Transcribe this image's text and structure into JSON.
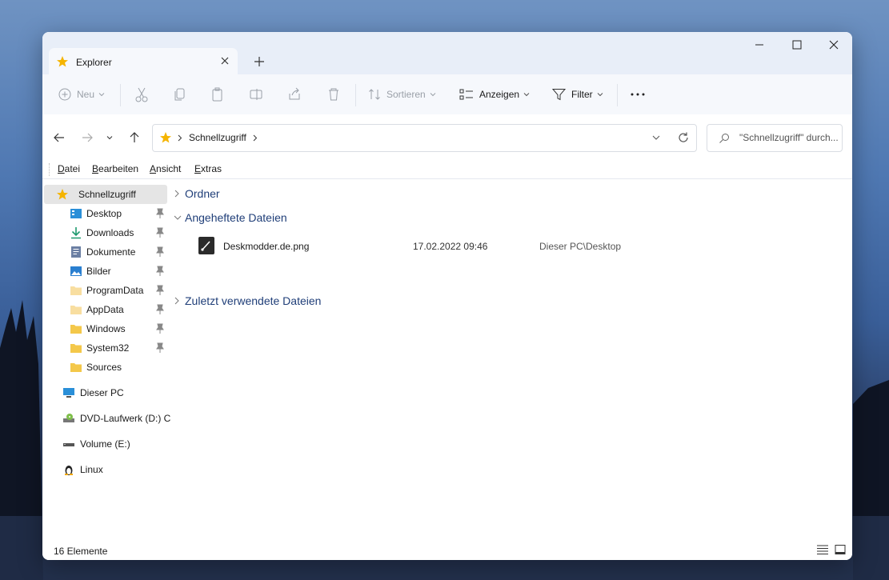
{
  "window": {
    "tab_title": "Explorer",
    "icons": {
      "tab": "star-icon",
      "close_tab": "close-icon",
      "new_tab": "plus-icon"
    }
  },
  "toolbar": {
    "new_label": "Neu",
    "sort_label": "Sortieren",
    "view_label": "Anzeigen",
    "filter_label": "Filter"
  },
  "address": {
    "crumbs": [
      "Schnellzugriff"
    ]
  },
  "search": {
    "placeholder": "\"Schnellzugriff\" durch..."
  },
  "menu": {
    "items": [
      {
        "label": "Datei",
        "key": "D",
        "rest": "atei"
      },
      {
        "label": "Bearbeiten",
        "key": "B",
        "rest": "earbeiten"
      },
      {
        "label": "Ansicht",
        "key": "A",
        "rest": "nsicht"
      },
      {
        "label": "Extras",
        "key": "E",
        "rest": "xtras"
      }
    ]
  },
  "sidebar": {
    "quick_access": "Schnellzugriff",
    "items": [
      {
        "label": "Desktop",
        "icon": "desktop-icon",
        "pinned": true
      },
      {
        "label": "Downloads",
        "icon": "download-icon",
        "pinned": true
      },
      {
        "label": "Dokumente",
        "icon": "document-icon",
        "pinned": true
      },
      {
        "label": "Bilder",
        "icon": "pictures-icon",
        "pinned": true
      },
      {
        "label": "ProgramData",
        "icon": "folder-icon",
        "pinned": true
      },
      {
        "label": "AppData",
        "icon": "folder-icon",
        "pinned": true
      },
      {
        "label": "Windows",
        "icon": "folder-icon",
        "pinned": true
      },
      {
        "label": "System32",
        "icon": "folder-icon",
        "pinned": true
      },
      {
        "label": "Sources",
        "icon": "folder-icon",
        "pinned": false
      }
    ],
    "drives": [
      {
        "label": "Dieser PC",
        "icon": "pc-icon"
      },
      {
        "label": "DVD-Laufwerk (D:) C",
        "icon": "dvd-icon"
      },
      {
        "label": "Volume (E:)",
        "icon": "drive-icon"
      },
      {
        "label": "Linux",
        "icon": "linux-icon"
      }
    ]
  },
  "content": {
    "groups": [
      {
        "label": "Ordner",
        "expanded": false
      },
      {
        "label": "Angeheftete Dateien",
        "expanded": true
      },
      {
        "label": "Zuletzt verwendete Dateien",
        "expanded": false
      }
    ],
    "files": [
      {
        "name": "Deskmodder.de.png",
        "date": "17.02.2022 09:46",
        "location": "Dieser PC\\Desktop"
      }
    ]
  },
  "status": {
    "count": "16 Elemente"
  },
  "colors": {
    "accent": "#1f3e78",
    "titlebar": "#e8eef8",
    "folder": "#f4c84a"
  }
}
